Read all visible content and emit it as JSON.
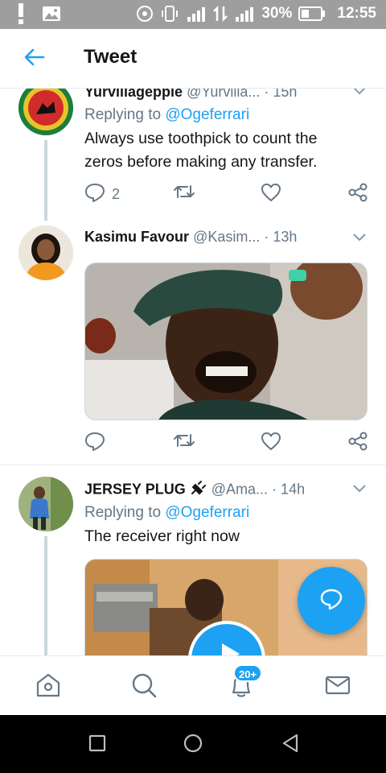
{
  "status_bar": {
    "battery_percent": "30%",
    "time": "12:55",
    "notification_icons": [
      "exclamation-icon",
      "image-icon"
    ],
    "system_icons": [
      "hotspot-icon",
      "vibrate-icon",
      "signal-icon",
      "data-icon",
      "signal-icon-2",
      "battery-icon"
    ]
  },
  "header": {
    "title": "Tweet",
    "back_icon": "arrow-left-icon"
  },
  "colors": {
    "accent": "#1da1f2",
    "secondary_text": "#657786",
    "primary_text": "#14171a",
    "status_bar": "#9e9e9e",
    "nav_bar": "#000000"
  },
  "tweets": [
    {
      "display_name": "Yurvillageppie",
      "handle": "@Yurvilla...",
      "time": "· 15h",
      "replying_label": "Replying to",
      "replying_to": "@Ogeferrari",
      "text": "Always use toothpick to count the zeros before making any transfer.",
      "reply_count": "2"
    },
    {
      "display_name": "Kasimu Favour",
      "handle": "@Kasim...",
      "time": "· 13h",
      "reply_count": ""
    },
    {
      "display_name": "JERSEY PLUG",
      "handle": "@Ama...",
      "time": "· 14h",
      "replying_label": "Replying to",
      "replying_to": "@Ogeferrari",
      "text": "The receiver right now"
    }
  ],
  "tab_bar": {
    "notifications_badge": "20+",
    "tabs": [
      "home-icon",
      "search-icon",
      "notifications-icon",
      "messages-icon"
    ]
  },
  "nav_bar": {
    "buttons": [
      "recents-icon",
      "home-circle-icon",
      "back-triangle-icon"
    ]
  }
}
